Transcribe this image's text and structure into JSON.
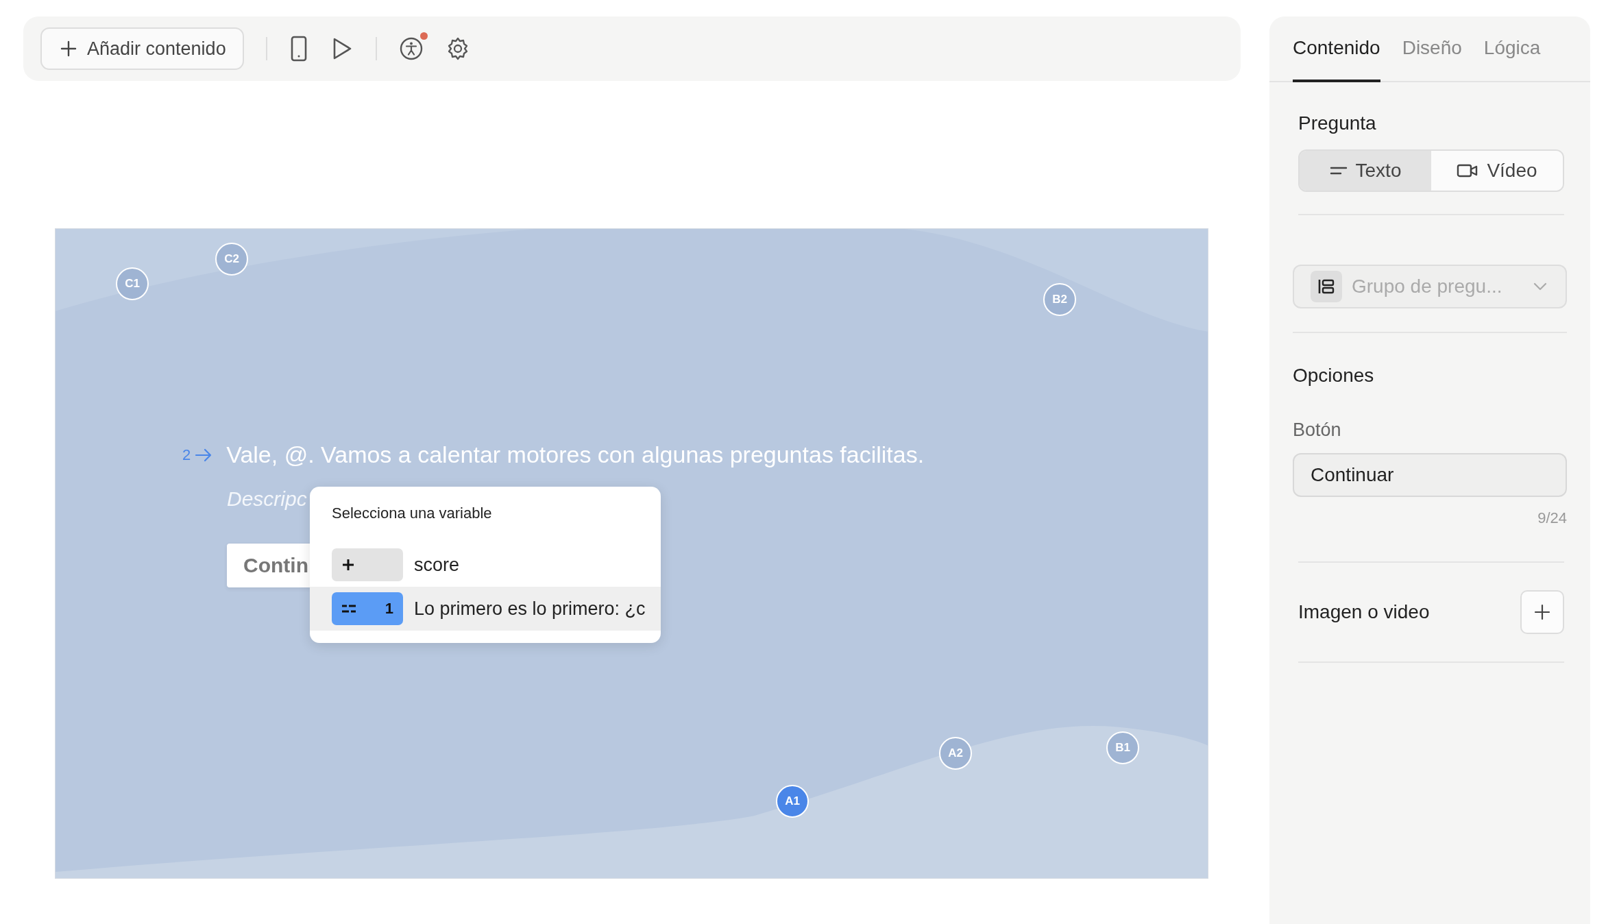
{
  "toolbar": {
    "add_button": "Añadir contenido",
    "accessibility_notification": true
  },
  "canvas": {
    "question_number": "2",
    "question": "Vale, @. Vamos a calentar motores con algunas preguntas facilitas.",
    "description_placeholder": "Descripc",
    "button": "Contin",
    "markers": [
      {
        "label": "C1",
        "selected": false
      },
      {
        "label": "C2",
        "selected": false
      },
      {
        "label": "B2",
        "selected": false
      },
      {
        "label": "A2",
        "selected": false
      },
      {
        "label": "B1",
        "selected": false
      },
      {
        "label": "A1",
        "selected": true
      }
    ]
  },
  "variable_menu": {
    "title": "Selecciona una variable",
    "items": [
      {
        "kind": "number",
        "label": "score",
        "selected": false
      },
      {
        "kind": "question",
        "badge": "1",
        "label": "Lo primero es lo primero: ¿c",
        "selected": true
      }
    ]
  },
  "panel": {
    "tabs": [
      {
        "label": "Contenido",
        "selected": true
      },
      {
        "label": "Diseño",
        "selected": false
      },
      {
        "label": "Lógica",
        "selected": false
      }
    ],
    "question_section": {
      "title": "Pregunta",
      "options": [
        {
          "kind": "text",
          "label": "Texto",
          "selected": true
        },
        {
          "kind": "video",
          "label": "Vídeo",
          "selected": false
        }
      ]
    },
    "group_select": {
      "placeholder": "Grupo de pregu..."
    },
    "options_section": {
      "title": "Opciones",
      "button_label": "Botón",
      "button_value": "Continuar",
      "counter": "9/24"
    },
    "media": {
      "title": "Imagen o video"
    }
  }
}
